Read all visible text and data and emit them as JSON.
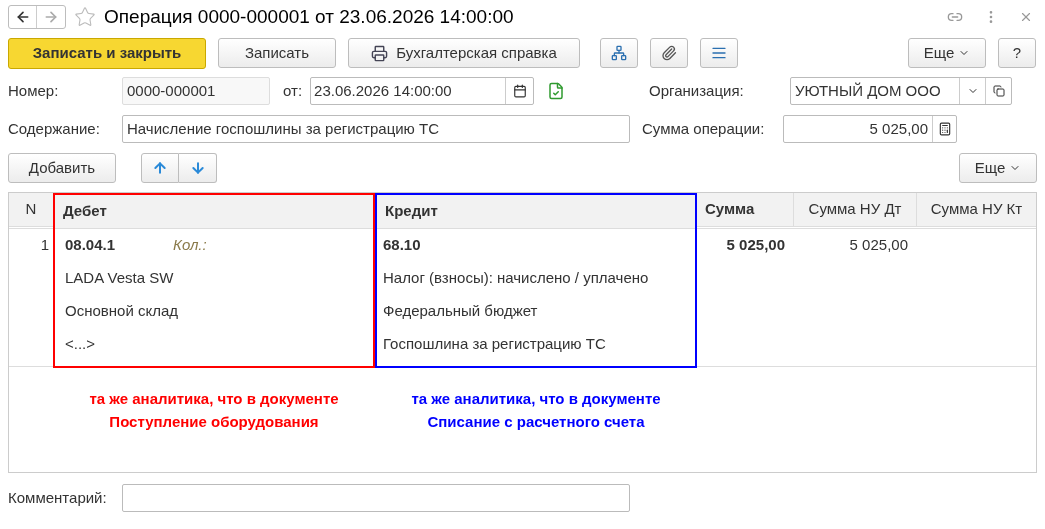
{
  "window": {
    "title": "Операция 0000-000001 от 23.06.2026 14:00:00"
  },
  "toolbar": {
    "primary": "Записать и закрыть",
    "save": "Записать",
    "report": "Бухгалтерская справка",
    "more": "Еще",
    "help": "?"
  },
  "header": {
    "number_label": "Номер:",
    "number": "0000-000001",
    "date_label": "от:",
    "date": "23.06.2026 14:00:00",
    "org_label": "Организация:",
    "org": "УЮТНЫЙ ДОМ ООО",
    "content_label": "Содержание:",
    "content": "Начисление госпошлины за регистрацию ТС",
    "sum_label": "Сумма операции:",
    "sum": "5 025,00"
  },
  "table_toolbar": {
    "add": "Добавить",
    "more": "Еще"
  },
  "table": {
    "columns": [
      {
        "label": "N",
        "bold": false
      },
      {
        "label": "Дебет",
        "bold": true,
        "color": "#ff0000"
      },
      {
        "label": "Кредит",
        "bold": true,
        "color": "#0000ff"
      },
      {
        "label": "Сумма",
        "bold": true
      },
      {
        "label": "Сумма НУ Дт",
        "bold": false
      },
      {
        "label": "Сумма НУ Кт",
        "bold": false
      }
    ],
    "rows": [
      {
        "n": "1",
        "debit": {
          "account": "08.04.1",
          "qty_label": "Кол.:",
          "lines": [
            "LADA Vesta SW",
            "Основной склад",
            "<...>"
          ]
        },
        "credit": {
          "account": "68.10",
          "lines": [
            "Налог (взносы): начислено / уплачено",
            "Федеральный бюджет",
            "Госпошлина за регистрацию ТС"
          ]
        },
        "sum": "5 025,00",
        "sum_nu_dt": "5 025,00"
      }
    ]
  },
  "annotations": [
    {
      "lines": [
        "та же аналитика, что в документе",
        "Поступление оборудования"
      ],
      "color": "#ff0000"
    },
    {
      "lines": [
        "та же аналитика, что в документе",
        "Списание с расчетного счета"
      ],
      "color": "#0000ff"
    }
  ],
  "comment": {
    "label": "Комментарий:"
  }
}
